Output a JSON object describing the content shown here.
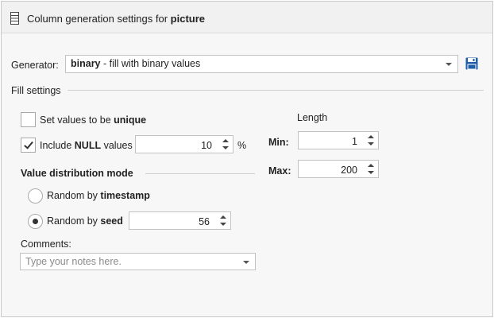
{
  "header": {
    "title_prefix": "Column generation settings for ",
    "title_column": "picture"
  },
  "generator": {
    "label": "Generator:",
    "selected_name": "binary",
    "selected_desc": " - fill with binary values"
  },
  "fill_settings": {
    "section_label": "Fill settings",
    "unique": {
      "prefix": "Set values to be ",
      "keyword": "unique",
      "checked": false
    },
    "include_null": {
      "prefix": "Include ",
      "keyword": "NULL",
      "suffix": " values",
      "checked": true,
      "value": "10",
      "unit": "%"
    },
    "distribution": {
      "section_label": "Value distribution mode",
      "timestamp": {
        "prefix": "Random by ",
        "keyword": "timestamp",
        "selected": false
      },
      "seed": {
        "prefix": "Random by ",
        "keyword": "seed",
        "selected": true,
        "value": "56"
      }
    },
    "length": {
      "section_label": "Length",
      "min_label": "Min:",
      "min_value": "1",
      "max_label": "Max:",
      "max_value": "200"
    },
    "comments": {
      "label": "Comments:",
      "placeholder": "Type your notes here."
    }
  },
  "colors": {
    "accent": "#1f5fa8"
  }
}
